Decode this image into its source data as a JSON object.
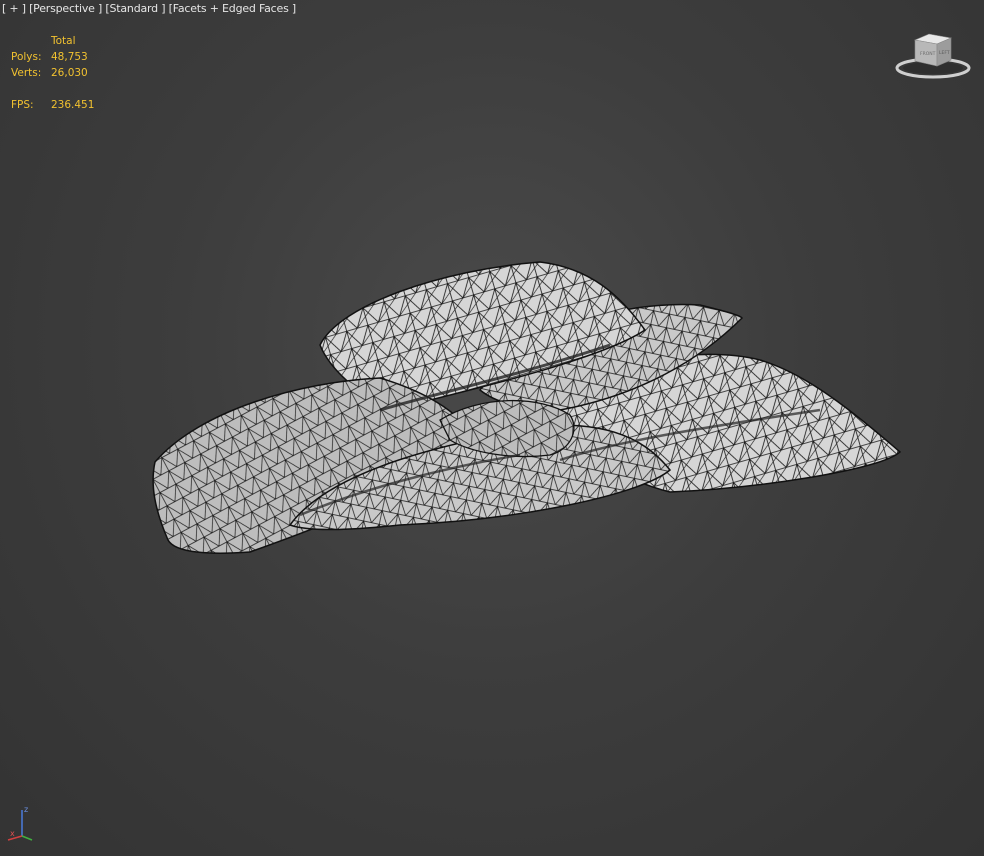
{
  "viewport": {
    "menu_plus": "[ + ]",
    "menu_view": "[Perspective ]",
    "menu_shading_mode": "[Standard ]",
    "menu_display": "[Facets + Edged Faces ]"
  },
  "stats": {
    "header": "Total",
    "polys_label": "Polys:",
    "polys_value": "48,753",
    "verts_label": "Verts:",
    "verts_value": "26,030",
    "fps_label": "FPS:",
    "fps_value": "236.451"
  },
  "viewcube": {
    "face_front": "FRONT",
    "face_left": "LEFT"
  },
  "axis": {
    "z": "z",
    "x": "x",
    "y": "y"
  },
  "colors": {
    "stats_text": "#f2c230",
    "label_text": "#e6e6e6",
    "background": "#3d3d3d",
    "mesh_face": "#d4d4d4",
    "mesh_edge": "#111111"
  }
}
